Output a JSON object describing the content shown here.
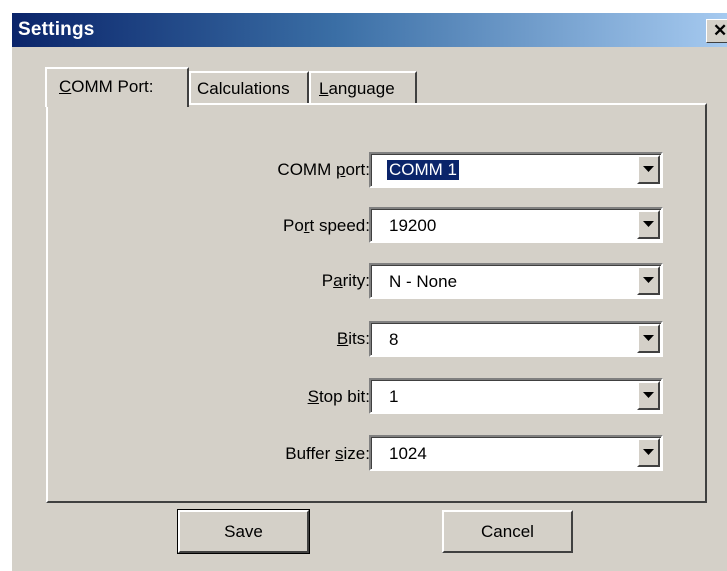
{
  "window": {
    "title": "Settings",
    "close_glyph": "✕"
  },
  "tabs": [
    {
      "pre": "",
      "key": "C",
      "post": "OMM Port:",
      "active": true
    },
    {
      "pre": "Calculations",
      "key": "",
      "post": "",
      "active": false
    },
    {
      "pre": "",
      "key": "L",
      "post": "anguage",
      "active": false
    }
  ],
  "fields": {
    "comm_port": {
      "pre": "COMM ",
      "key": "p",
      "post": "ort:",
      "value": "COMM 1"
    },
    "port_speed": {
      "pre": "Po",
      "key": "r",
      "post": "t speed:",
      "value": "19200"
    },
    "parity": {
      "pre": "P",
      "key": "a",
      "post": "rity:",
      "value": "N - None"
    },
    "bits": {
      "pre": "",
      "key": "B",
      "post": "its:",
      "value": "8"
    },
    "stop_bit": {
      "pre": "",
      "key": "S",
      "post": "top bit:",
      "value": "1"
    },
    "buffer_size": {
      "pre": "Buffer ",
      "key": "s",
      "post": "ize:",
      "value": "1024"
    }
  },
  "buttons": {
    "save": "Save",
    "cancel": "Cancel"
  },
  "colors": {
    "titlebar_start": "#0a246a",
    "titlebar_end": "#a6caf0",
    "face": "#d4d0c8",
    "selection": "#0a246a"
  }
}
